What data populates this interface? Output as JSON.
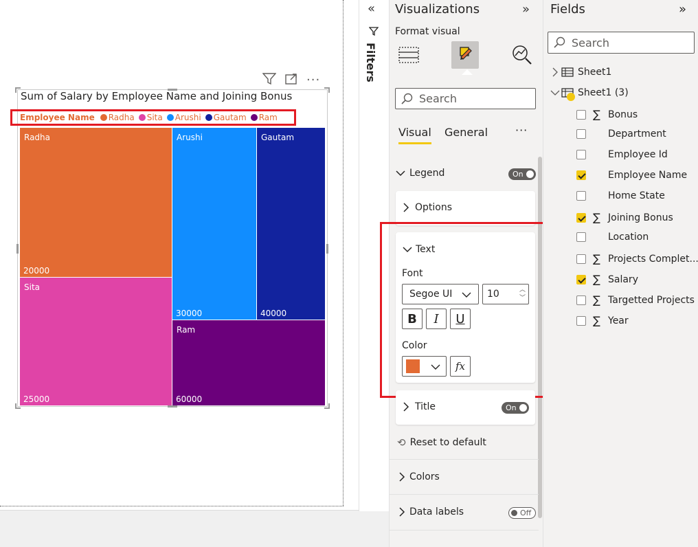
{
  "visual": {
    "title": "Sum of Salary by Employee Name and Joining Bonus",
    "legend": {
      "title": "Employee Name",
      "items": [
        {
          "name": "Radha",
          "color": "#e36b33"
        },
        {
          "name": "Sita",
          "color": "#e044a7"
        },
        {
          "name": "Arushi",
          "color": "#118dff"
        },
        {
          "name": "Gautam",
          "color": "#12239e"
        },
        {
          "name": "Ram",
          "color": "#6b007b"
        }
      ]
    },
    "tiles": [
      {
        "name": "Radha",
        "value": "20000",
        "color": "#e36b33"
      },
      {
        "name": "Sita",
        "value": "25000",
        "color": "#e044a7"
      },
      {
        "name": "Arushi",
        "value": "30000",
        "color": "#118dff"
      },
      {
        "name": "Gautam",
        "value": "40000",
        "color": "#12239e"
      },
      {
        "name": "Ram",
        "value": "60000",
        "color": "#6b007b"
      }
    ]
  },
  "filters": {
    "label": "Filters"
  },
  "visualizations": {
    "title": "Visualizations",
    "format_visual": "Format visual",
    "search_placeholder": "Search",
    "tabs": {
      "visual": "Visual",
      "general": "General",
      "more": "···"
    },
    "legend": {
      "label": "Legend",
      "toggle": "On"
    },
    "options": {
      "label": "Options"
    },
    "text": {
      "label": "Text",
      "font_label": "Font",
      "font_family": "Segoe UI",
      "font_size": "10",
      "bold": "B",
      "italic": "I",
      "underline": "U",
      "color_label": "Color",
      "color_value": "#e36b33",
      "fx": "fx"
    },
    "title_section": {
      "label": "Title",
      "toggle": "On"
    },
    "reset": "Reset to default",
    "colors": {
      "label": "Colors"
    },
    "data_labels": {
      "label": "Data labels",
      "toggle": "Off"
    }
  },
  "fields": {
    "title": "Fields",
    "search_placeholder": "Search",
    "tables": [
      {
        "name": "Sheet1"
      },
      {
        "name": "Sheet1 (3)"
      }
    ],
    "items": [
      {
        "name": "Bonus",
        "sigma": true,
        "checked": false
      },
      {
        "name": "Department",
        "sigma": false,
        "checked": false
      },
      {
        "name": "Employee Id",
        "sigma": false,
        "checked": false
      },
      {
        "name": "Employee Name",
        "sigma": false,
        "checked": true
      },
      {
        "name": "Home State",
        "sigma": false,
        "checked": false
      },
      {
        "name": "Joining Bonus",
        "sigma": true,
        "checked": true
      },
      {
        "name": "Location",
        "sigma": false,
        "checked": false
      },
      {
        "name": "Projects Complet...",
        "sigma": true,
        "checked": false
      },
      {
        "name": "Salary",
        "sigma": true,
        "checked": true
      },
      {
        "name": "Targetted Projects",
        "sigma": true,
        "checked": false
      },
      {
        "name": "Year",
        "sigma": true,
        "checked": false
      }
    ]
  }
}
